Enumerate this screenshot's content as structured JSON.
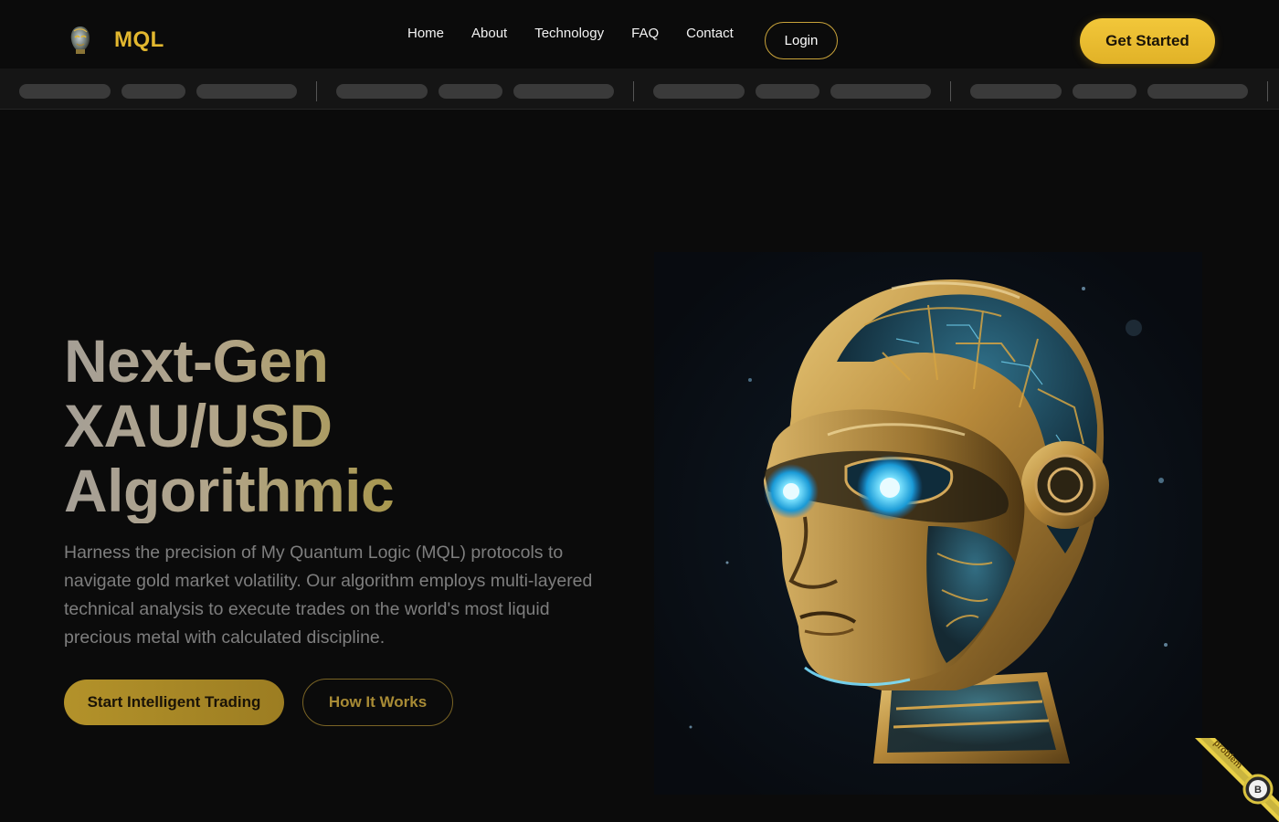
{
  "nav": {
    "brand": "MQL",
    "logo_icon": "robot-head-logo-icon",
    "links": [
      {
        "label": "Home"
      },
      {
        "label": "About"
      },
      {
        "label": "Technology"
      },
      {
        "label": "FAQ"
      },
      {
        "label": "Contact"
      }
    ],
    "login_label": "Login",
    "cta_label": "Get Started"
  },
  "hero": {
    "title_lines": [
      "Next-Gen",
      "XAU/USD",
      "Algorithmic"
    ],
    "description": "Harness the precision of My Quantum Logic (MQL) protocols to navigate gold market volatility. Our algorithm employs multi-layered technical analysis to execute trades on the world's most liquid precious metal with calculated discipline.",
    "primary_button": "Start Intelligent Trading",
    "secondary_button": "How It Works",
    "image_icon": "golden-robot-head-illustration"
  },
  "corner_badge": {
    "ribbon_text": "problem",
    "circle_letter": "B"
  },
  "colors": {
    "background": "#0b0b0b",
    "accent_gold": "#e3b82f",
    "ticker_bg": "#151515",
    "muted_text": "#7e7e7e"
  }
}
